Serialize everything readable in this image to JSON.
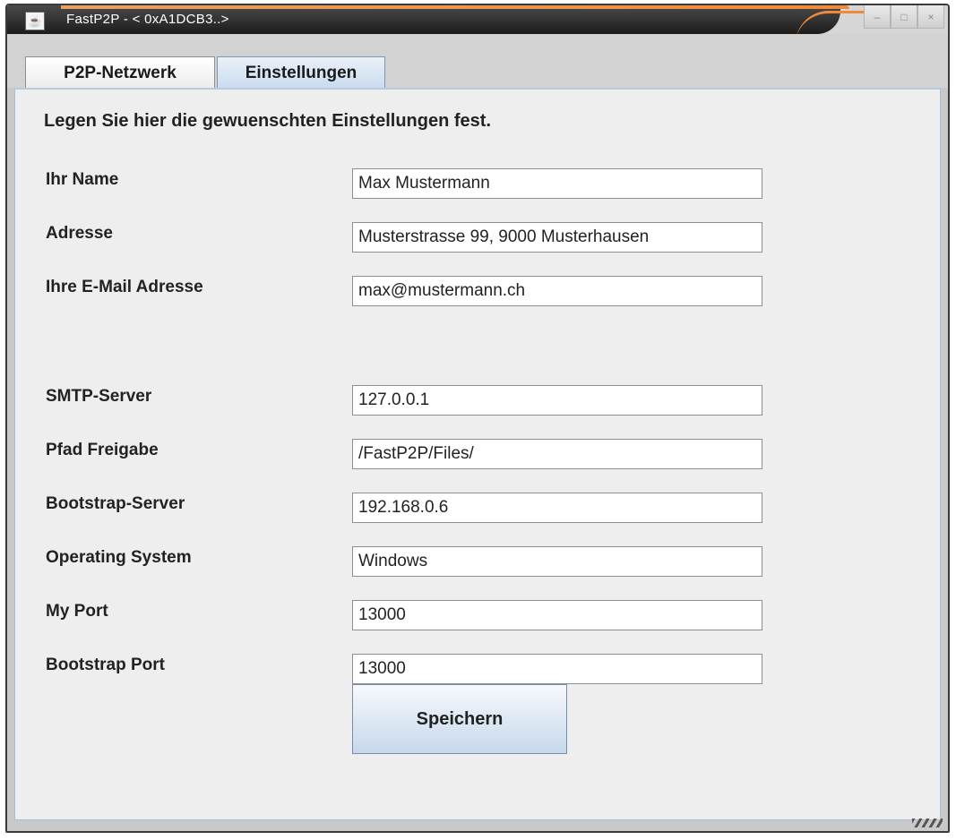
{
  "window": {
    "title": "FastP2P - < 0xA1DCB3..>",
    "controls": [
      {
        "name": "minimize-icon",
        "glyph": "–"
      },
      {
        "name": "maximize-icon",
        "glyph": "□"
      },
      {
        "name": "close-icon",
        "glyph": "×"
      }
    ],
    "accent_color": "#f08a3a"
  },
  "tabs": [
    {
      "label": "P2P-Netzwerk",
      "selected": false
    },
    {
      "label": "Einstellungen",
      "selected": true
    }
  ],
  "settings": {
    "intro": "Legen Sie hier die gewuenschten Einstellungen fest.",
    "fields": {
      "name": {
        "label": "Ihr Name",
        "value": "Max Mustermann"
      },
      "address": {
        "label": "Adresse",
        "value": "Musterstrasse 99, 9000 Musterhausen"
      },
      "email": {
        "label": "Ihre E-Mail Adresse",
        "value": "max@mustermann.ch"
      },
      "smtp": {
        "label": "SMTP-Server",
        "value": "127.0.0.1"
      },
      "share_path": {
        "label": "Pfad Freigabe",
        "value": "/FastP2P/Files/"
      },
      "bootstrap_server": {
        "label": "Bootstrap-Server",
        "value": "192.168.0.6"
      },
      "os": {
        "label": "Operating System",
        "value": "Windows"
      },
      "my_port": {
        "label": "My Port",
        "value": "13000"
      },
      "bootstrap_port": {
        "label": "Bootstrap Port",
        "value": "13000"
      }
    },
    "save_label": "Speichern"
  }
}
